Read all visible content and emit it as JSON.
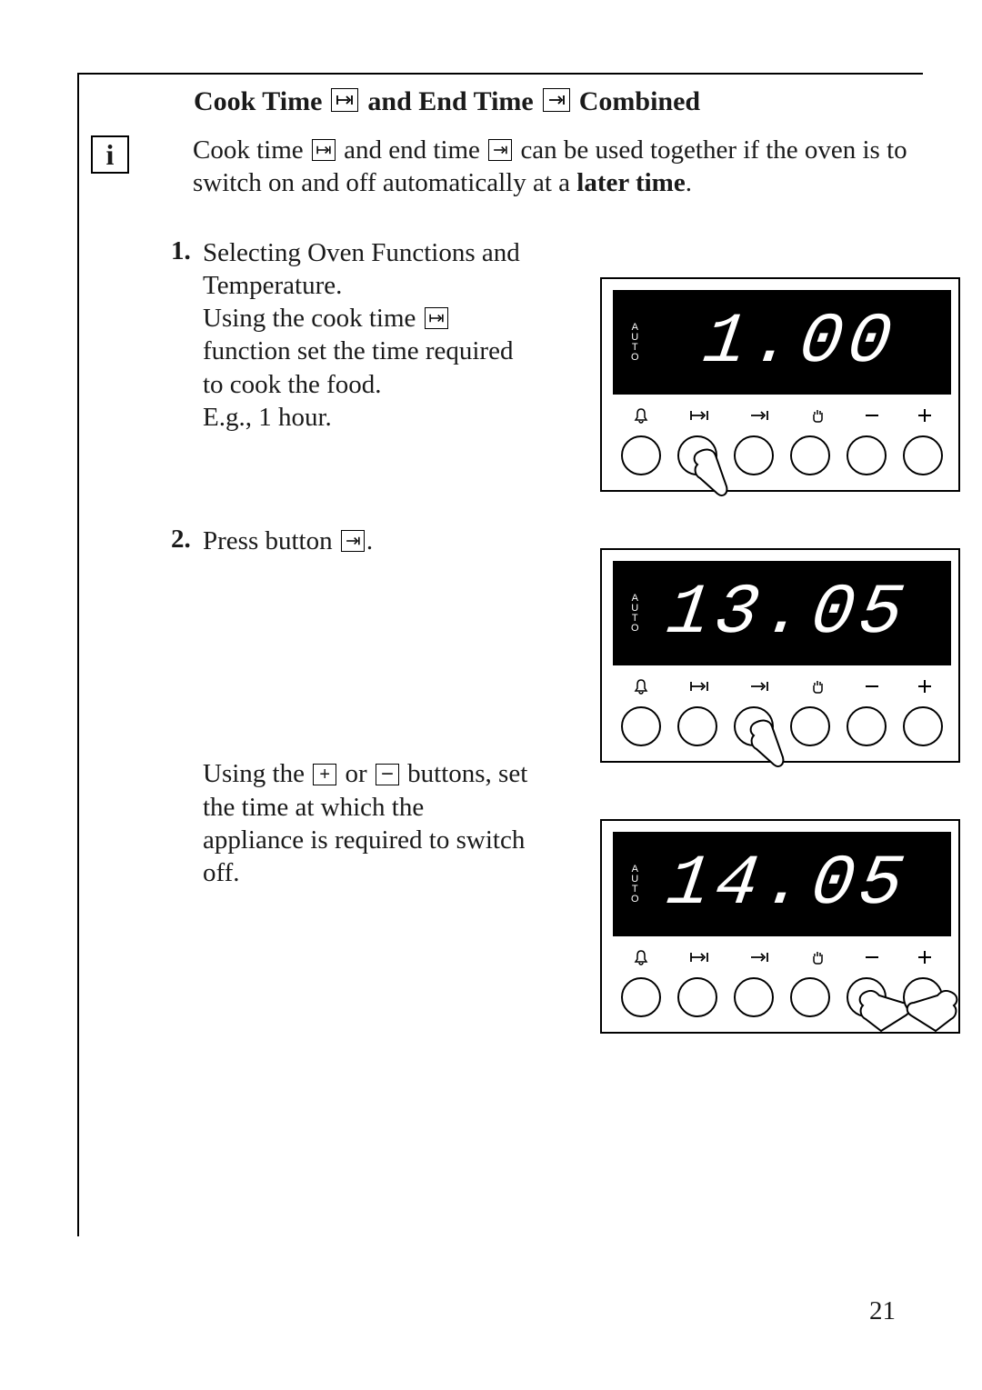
{
  "heading": {
    "part1": "Cook Time",
    "part2": "and End Time",
    "part3": "Combined"
  },
  "info": {
    "text1": "Cook time",
    "text2": "and end time",
    "text3": "can be used together if the oven is to switch on and off automatically at a",
    "bold": "later time",
    "period": "."
  },
  "steps": {
    "s1num": "1.",
    "s1a": "Selecting Oven Functions and Temperature.",
    "s1b": "Using the cook time",
    "s1c": "function set the time required to cook the food.",
    "s1d": "E.g., 1 hour.",
    "s2num": "2.",
    "s2a": "Press button",
    "s2period": ".",
    "s3a": "Using the",
    "s3b": "or",
    "s3c": "buttons, set the time at which the appliance is required to switch off."
  },
  "displays": {
    "auto": "AUTO",
    "time1": "1.00",
    "time2": "13.05",
    "time3": "14.05"
  },
  "pagenum": "21"
}
